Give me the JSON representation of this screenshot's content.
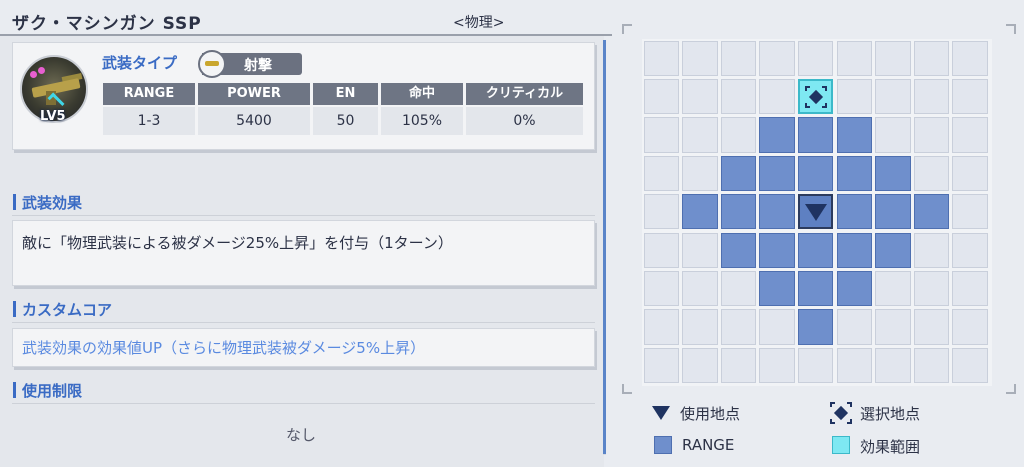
{
  "header": {
    "weapon_name": "ザク・マシンガン SSP",
    "category": "<物理>"
  },
  "weapon": {
    "level_badge": "LV5",
    "type_label": "武装タイプ",
    "type_value": "射撃",
    "stats": {
      "headers": [
        "RANGE",
        "POWER",
        "EN",
        "命中",
        "クリティカル"
      ],
      "values": [
        "1-3",
        "5400",
        "50",
        "105%",
        "0%"
      ]
    }
  },
  "sections": {
    "effect": {
      "title": "武装効果",
      "text": "敵に「物理武装による被ダメージ25%上昇」を付与（1ターン）"
    },
    "custom_core": {
      "title": "カスタムコア",
      "text": "武装効果の効果値UP（さらに物理武装被ダメージ5%上昇）"
    },
    "restriction": {
      "title": "使用制限",
      "text": "なし"
    }
  },
  "range_grid": {
    "cols": 9,
    "rows": 9,
    "origin": [
      4,
      4
    ],
    "target": [
      4,
      1
    ],
    "range_cells": [
      [
        3,
        2
      ],
      [
        4,
        2
      ],
      [
        5,
        2
      ],
      [
        2,
        3
      ],
      [
        3,
        3
      ],
      [
        4,
        3
      ],
      [
        5,
        3
      ],
      [
        6,
        3
      ],
      [
        1,
        4
      ],
      [
        2,
        4
      ],
      [
        3,
        4
      ],
      [
        5,
        4
      ],
      [
        6,
        4
      ],
      [
        7,
        4
      ],
      [
        2,
        5
      ],
      [
        3,
        5
      ],
      [
        4,
        5
      ],
      [
        5,
        5
      ],
      [
        6,
        5
      ],
      [
        3,
        6
      ],
      [
        4,
        6
      ],
      [
        5,
        6
      ],
      [
        4,
        7
      ]
    ]
  },
  "legend": {
    "use_point": "使用地点",
    "select_point": "選択地点",
    "range": "RANGE",
    "effect_area": "効果範囲"
  },
  "colors": {
    "accent_blue": "#3a6bc4",
    "range_cell": "#6f8fcc",
    "effect_cell": "#7ee8f2",
    "marker": "#1f3361"
  }
}
